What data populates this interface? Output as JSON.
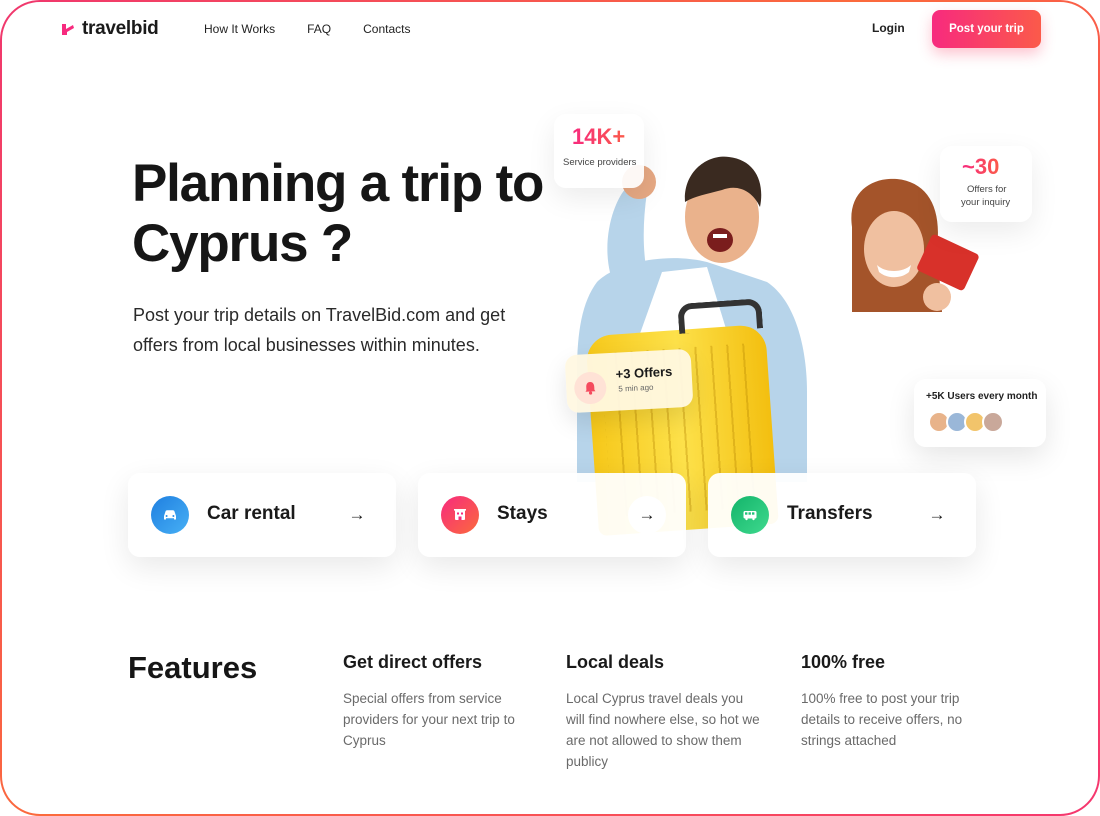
{
  "brand": {
    "name": "travelbid",
    "accent": "#f72a7e",
    "accent_2": "#fb5a4a"
  },
  "nav": {
    "links": [
      "How It Works",
      "FAQ",
      "Contacts"
    ],
    "login_label": "Login",
    "cta_label": "Post your trip"
  },
  "hero": {
    "title": "Planning a trip to Cyprus ?",
    "subtitle": "Post your trip details on TravelBid.com and get offers from local businesses within minutes.",
    "stats": {
      "providers_value": "14K+",
      "providers_label": "Service providers",
      "offers_value": "~30",
      "offers_label_line1": "Offers for",
      "offers_label_line2": "your inquiry"
    },
    "offers_chip": {
      "title": "+3 Offers",
      "time": "5 min ago"
    },
    "users_chip": {
      "title": "+5K Users every month"
    }
  },
  "services": [
    {
      "label": "Car rental",
      "icon": "car-icon",
      "color": "#2b8fe8"
    },
    {
      "label": "Stays",
      "icon": "hotel-icon",
      "color": "#f72a7e"
    },
    {
      "label": "Transfers",
      "icon": "bus-icon",
      "color": "#22c47a"
    }
  ],
  "features": {
    "title": "Features",
    "items": [
      {
        "title": "Get direct offers",
        "text": "Special offers from service providers for your next trip to Cyprus"
      },
      {
        "title": "Local deals",
        "text": "Local Cyprus travel deals you will find nowhere else, so hot we are not allowed to show them publicy"
      },
      {
        "title": "100% free",
        "text": "100% free to post your trip details to receive offers, no strings attached"
      }
    ]
  }
}
